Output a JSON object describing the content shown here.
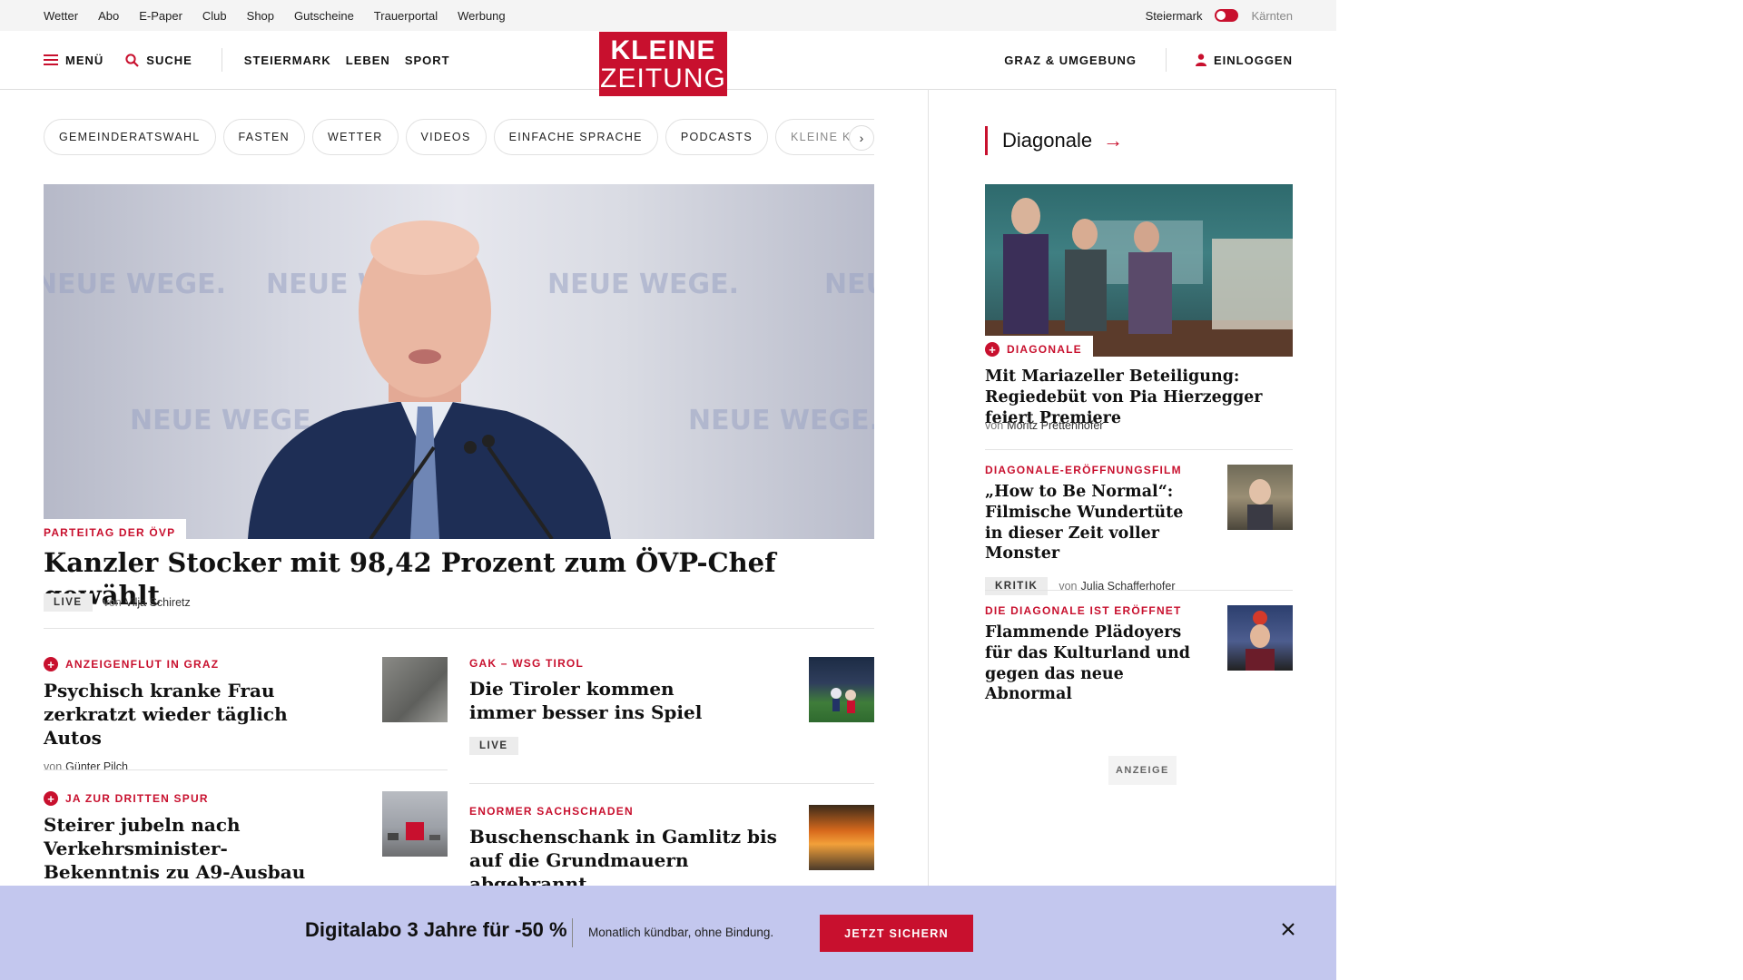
{
  "utility_links": [
    "Wetter",
    "Abo",
    "E-Paper",
    "Club",
    "Shop",
    "Gutscheine",
    "Trauerportal",
    "Werbung"
  ],
  "region": {
    "active": "Steiermark",
    "inactive": "Kärnten"
  },
  "header": {
    "menu_label": "MENÜ",
    "search_label": "SUCHE",
    "nav": [
      "STEIERMARK",
      "LEBEN",
      "SPORT"
    ],
    "logo_line1": "KLEINE",
    "logo_line2": "ZEITUNG",
    "local_label": "GRAZ & UMGEBUNG",
    "login_label": "EINLOGGEN"
  },
  "chips": [
    "GEMEINDERATSWAHL",
    "FASTEN",
    "WETTER",
    "VIDEOS",
    "EINFACHE SPRACHE",
    "PODCASTS",
    "KLEINE KINDE"
  ],
  "hero": {
    "kicker": "PARTEITAG DER ÖVP",
    "title": "Kanzler Stocker mit 98,42 Prozent zum ÖVP-Chef gewählt",
    "badge": "LIVE",
    "by_prefix": "von",
    "author": "Vilja Schiretz",
    "backdrop_text": "NEUE WEGE."
  },
  "teasers": [
    {
      "kicker": "ANZEIGENFLUT IN GRAZ",
      "title": "Psychisch kranke Frau zerkratzt wieder täglich Autos",
      "by_prefix": "von",
      "author": "Günter Pilch",
      "plus": true
    },
    {
      "kicker": "GAK – WSG TIROL",
      "title": "Die Tiroler kommen immer besser ins Spiel",
      "badge": "LIVE",
      "plus": false
    },
    {
      "kicker": "JA ZUR DRITTEN SPUR",
      "title": "Steirer jubeln nach Verkehrsminister-Bekenntnis zu A9-Ausbau",
      "plus": true
    },
    {
      "kicker": "ENORMER SACHSCHADEN",
      "title": "Buschenschank in Gamlitz bis auf die Grundmauern abgebrannt",
      "plus": false
    }
  ],
  "sidebar": {
    "section_title": "Diagonale",
    "featured": {
      "kicker": "DIAGONALE",
      "title": "Mit Mariazeller Beteiligung: Regiedebüt von Pia Hierzegger feiert Premiere",
      "by_prefix": "von",
      "author": "Moritz Prettenhofer"
    },
    "items": [
      {
        "kicker": "DIAGONALE-ERÖFFNUNGSFILM",
        "title": "„How to Be Normal“: Filmische Wundertüte in dieser Zeit voller Monster",
        "badge": "KRITIK",
        "by_prefix": "von",
        "author": "Julia Schafferhofer"
      },
      {
        "kicker": "DIE DIAGONALE IST ERÖFFNET",
        "title": "Flammende Plädoyers für das Kulturland und gegen das neue Abnormal"
      }
    ],
    "ad_label": "ANZEIGE"
  },
  "banner": {
    "title": "Digitalabo 3 Jahre für -50 %",
    "subtitle": "Monatlich kündbar, ohne Bindung.",
    "cta": "JETZT SICHERN"
  },
  "colors": {
    "brand_red": "#c8102e",
    "banner_bg": "#c3c7ee",
    "util_bg": "#f4f4f4"
  }
}
